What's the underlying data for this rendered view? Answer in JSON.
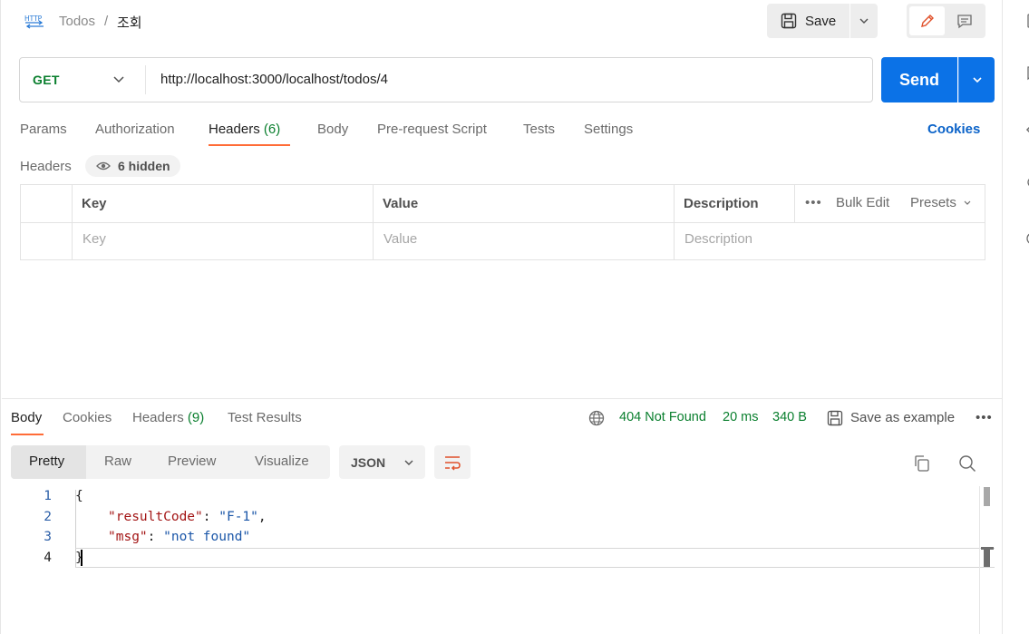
{
  "header": {
    "icon": "http-icon",
    "breadcrumb_parent": "Todos",
    "breadcrumb_sep": "/",
    "breadcrumb_current": "조회",
    "save_label": "Save"
  },
  "request": {
    "method": "GET",
    "url": "http://localhost:3000/localhost/todos/4",
    "send_label": "Send"
  },
  "request_tabs": [
    {
      "label": "Params",
      "count": ""
    },
    {
      "label": "Authorization",
      "count": ""
    },
    {
      "label": "Headers",
      "count": "(6)",
      "active": true
    },
    {
      "label": "Body",
      "count": ""
    },
    {
      "label": "Pre-request Script",
      "count": ""
    },
    {
      "label": "Tests",
      "count": ""
    },
    {
      "label": "Settings",
      "count": ""
    }
  ],
  "cookies_link": "Cookies",
  "headers_section": {
    "title": "Headers",
    "hidden_label": "6 hidden",
    "columns": [
      "Key",
      "Value",
      "Description"
    ],
    "placeholders": [
      "Key",
      "Value",
      "Description"
    ],
    "more": "•••",
    "bulk_edit": "Bulk Edit",
    "presets": "Presets"
  },
  "response_tabs": [
    {
      "label": "Body",
      "count": "",
      "active": true
    },
    {
      "label": "Cookies",
      "count": ""
    },
    {
      "label": "Headers",
      "count": "(9)"
    },
    {
      "label": "Test Results",
      "count": ""
    }
  ],
  "response_status": {
    "status": "404 Not Found",
    "time": "20 ms",
    "size": "340 B",
    "save_example": "Save as example",
    "more": "•••"
  },
  "format_tabs": [
    "Pretty",
    "Raw",
    "Preview",
    "Visualize"
  ],
  "format_select": "JSON",
  "code": {
    "line_numbers": [
      "1",
      "2",
      "3",
      "4"
    ],
    "open_brace": "{",
    "close_brace": "}",
    "key1": "\"resultCode\"",
    "val1": "\"F-1\"",
    "key2": "\"msg\"",
    "val2": "\"not found\""
  },
  "colors": {
    "accent": "#ff6c37",
    "send": "#0b72e7",
    "status_ok_green": "#0a7f2e",
    "link": "#0b63c9"
  }
}
